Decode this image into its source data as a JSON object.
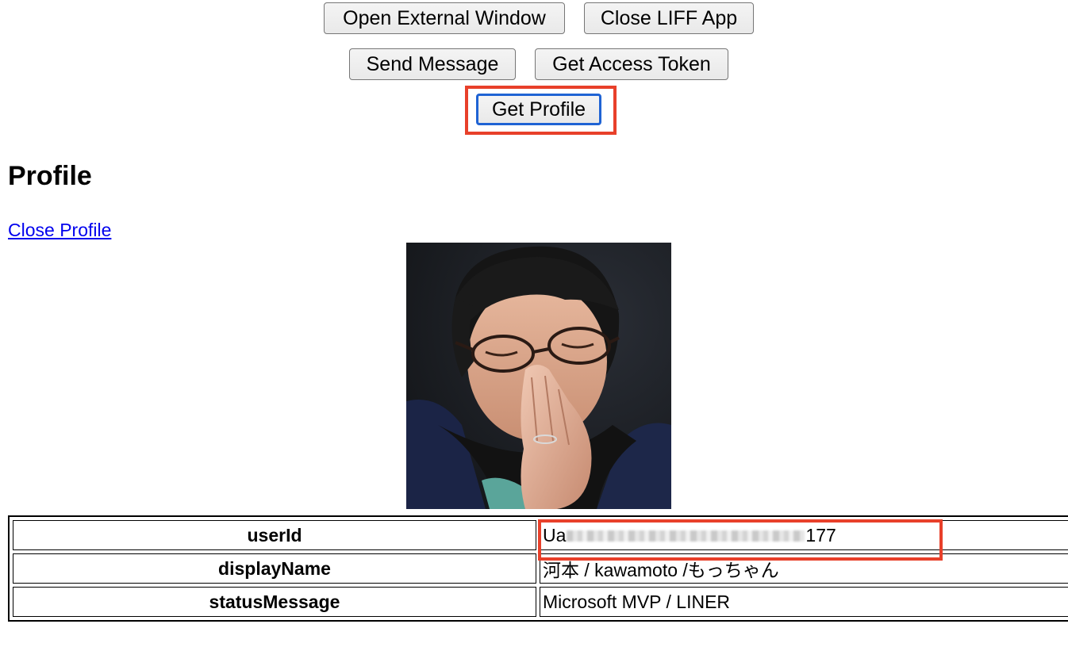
{
  "toolbar": {
    "open_external_window": "Open External Window",
    "close_liff_app": "Close LIFF App",
    "send_message": "Send Message",
    "get_access_token": "Get Access Token",
    "get_profile": "Get Profile"
  },
  "profile": {
    "heading": "Profile",
    "close_link": "Close Profile",
    "picture_alt": "profile-photo",
    "rows": [
      {
        "key": "userId",
        "value_prefix": "Ua",
        "value_suffix": "177",
        "masked": true
      },
      {
        "key": "displayName",
        "value": "河本 / kawamoto /もっちゃん"
      },
      {
        "key": "statusMessage",
        "value": "Microsoft MVP / LINER"
      }
    ]
  },
  "colors": {
    "annotation": "#e8402a",
    "focus_ring": "#1f63d4",
    "link": "#0000ee"
  }
}
